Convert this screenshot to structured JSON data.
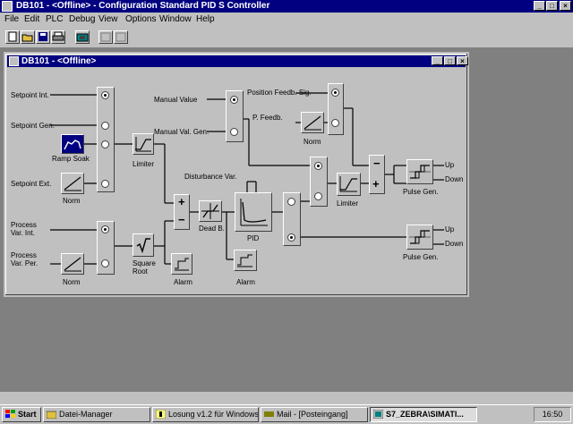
{
  "app": {
    "title": "DB101 - <Offline> - Configuration Standard PID S Controller",
    "window_buttons": [
      "_",
      "□",
      "×"
    ]
  },
  "menu": [
    "File",
    "Edit",
    "PLC",
    "Debug",
    "View",
    "Options",
    "Window",
    "Help"
  ],
  "toolbar": {
    "buttons": [
      "new-icon",
      "open-icon",
      "save-icon",
      "print-icon",
      "download-icon",
      "disabled-icon",
      "disabled-icon"
    ]
  },
  "child_window": {
    "title": "DB101 - <Offline>"
  },
  "diagram": {
    "setpoint_int": "Setpoint Int.",
    "setpoint_gen": "Setpoint Gen.",
    "ramp_soak": "Ramp Soak",
    "setpoint_ext": "Setpoint Ext.",
    "norm_sp": "Norm",
    "limiter_sp": "Limiter",
    "process_var_int": "Process\nVar. Int.",
    "process_var_per": "Process\nVar. Per.",
    "norm_pv": "Norm",
    "square_root": "Square\nRoot",
    "alarm_1": "Alarm",
    "dead_b": "Dead B.",
    "pid": "PID",
    "alarm_2": "Alarm",
    "disturbance_var": "Disturbance Var.",
    "manual_value": "Manual Value",
    "manual_val_gen": "Manual Val. Gen.",
    "position_feedb_sig": "Position Feedb. Sig.",
    "p_feedb": "P. Feedb.",
    "norm_pf": "Norm",
    "limiter_out": "Limiter",
    "pulse_gen_1": "Pulse Gen.",
    "pulse_gen_2": "Pulse Gen.",
    "up_1": "Up",
    "down_1": "Down",
    "up_2": "Up",
    "down_2": "Down",
    "plus": "+",
    "minus": "−"
  },
  "taskbar": {
    "start": "Start",
    "items": [
      {
        "label": "Datei-Manager",
        "icon": "file-manager-icon"
      },
      {
        "label": "Losung v1.2 für Windows",
        "icon": "help-icon"
      },
      {
        "label": "Mail - [Posteingang]",
        "icon": "mail-icon"
      },
      {
        "label": "S7_ZEBRA\\SIMATI...",
        "icon": "simatic-icon"
      }
    ],
    "clock": "16:50"
  }
}
